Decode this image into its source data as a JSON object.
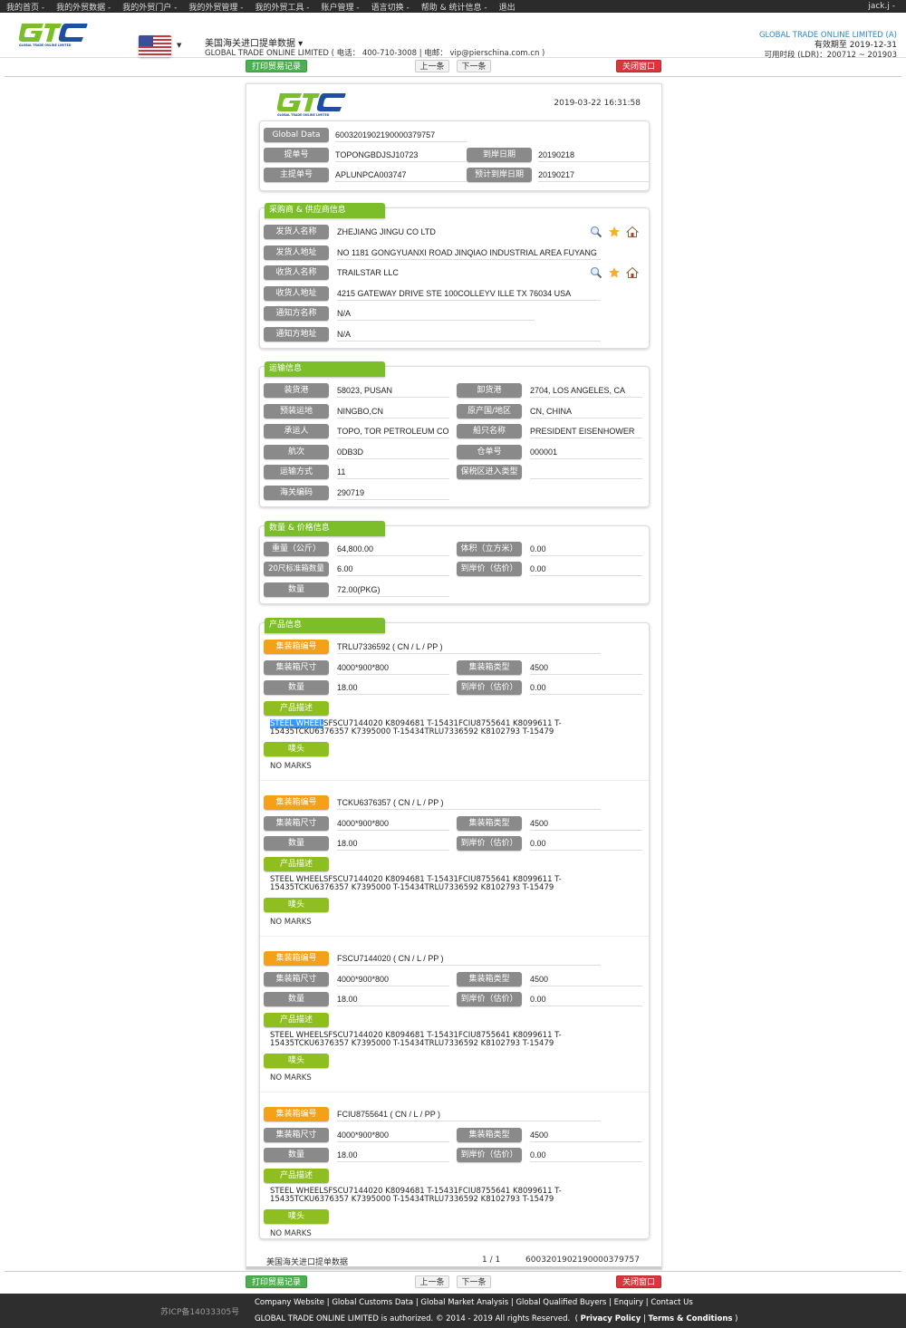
{
  "topnav": {
    "items": [
      "我的首页 -",
      "我的外贸数据 -",
      "我的外贸门户 -",
      "我的外贸管理 -",
      "我的外贸工具 -",
      "账户管理 -",
      "语言切换 -",
      "帮助 & 统计信息 -",
      "退出"
    ],
    "user": "jack.j -"
  },
  "header": {
    "logo_text": "GLOBAL TRADE ONLINE LIMITED",
    "flag": "us-flag",
    "db_title": "美国海关进口提单数据 ▾",
    "db_sub": "GLOBAL TRADE ONLINE LIMITED ( 电话： 400-710-3008 | 电邮： vip@pierschina.com.cn )",
    "company": "GLOBAL TRADE ONLINE LIMITED (A)",
    "valid_until": "有效期至 2019-12-31",
    "ldr": "可用时段 (LDR)：200712 ~ 201903"
  },
  "actions": {
    "print": "打印贸易记录",
    "prev": "上一条",
    "next": "下一条",
    "close": "关闭窗口"
  },
  "doc": {
    "timestamp": "2019-03-22 16:31:58",
    "basic": {
      "global_data_label": "Global Data",
      "global_data": "6003201902190000379757",
      "bill_no_label": "提单号",
      "bill_no": "TOPONGBDJSJ10723",
      "arrival_date_label": "到岸日期",
      "arrival_date": "20190218",
      "master_bill_label": "主提单号",
      "master_bill": "APLUNPCA003747",
      "est_arrival_label": "预计到岸日期",
      "est_arrival": "20190217"
    },
    "parties": {
      "title": "采购商 & 供应商信息",
      "shipper_name_label": "发货人名称",
      "shipper_name": "ZHEJIANG JINGU CO LTD",
      "shipper_addr_label": "发货人地址",
      "shipper_addr": " NO 1181 GONGYUANXI ROAD JINQIAO INDUSTRIAL AREA FUYANG",
      "consignee_name_label": "收货人名称",
      "consignee_name": "TRAILSTAR LLC",
      "consignee_addr_label": "收货人地址",
      "consignee_addr": "4215 GATEWAY DRIVE STE 100COLLEYV ILLE TX 76034 USA",
      "notify_name_label": "通知方名称",
      "notify_name": "N/A",
      "notify_addr_label": "通知方地址",
      "notify_addr": "N/A"
    },
    "transport": {
      "title": "运输信息",
      "load_port_label": "装货港",
      "load_port": "58023, PUSAN",
      "unload_port_label": "卸货港",
      "unload_port": "2704, LOS ANGELES, CA",
      "pre_load_label": "预装运地",
      "pre_load": "NINGBO,CN",
      "origin_label": "原产国/地区",
      "origin": "CN, CHINA",
      "carrier_label": "承运人",
      "carrier": "TOPO, TOR PETROLEUM CO",
      "vessel_label": "船只名称",
      "vessel": "PRESIDENT EISENHOWER",
      "voyage_label": "航次",
      "voyage": "0DB3D",
      "manifest_label": "仓单号",
      "manifest": "000001",
      "mode_label": "运输方式",
      "mode": "11",
      "bonded_label": "保税区进入类型",
      "bonded": "",
      "customs_code_label": "海关编码",
      "customs_code": "290719"
    },
    "quantity": {
      "title": "数量 & 价格信息",
      "weight_label": "重量（公斤）",
      "weight": "64,800.00",
      "volume_label": "体积（立方米）",
      "volume": "0.00",
      "teu_label": "20尺标准箱数量",
      "teu": "6.00",
      "value_label": "到岸价（估价）",
      "value": "0.00",
      "qty_label": "数量",
      "qty": "72.00(PKG)"
    },
    "products": {
      "title": "产品信息",
      "labels": {
        "container_no": "集装箱编号",
        "container_size": "集装箱尺寸",
        "container_type": "集装箱类型",
        "qty": "数量",
        "value": "到岸价（估价）",
        "desc": "产品描述",
        "marks": "唛头"
      },
      "items": [
        {
          "container_no": "TRLU7336592 ( CN / L / PP )",
          "size": "4000*900*800",
          "type": "4500",
          "qty": "18.00",
          "value": "0.00",
          "desc_highlight": "STEEL WHEEL",
          "desc_rest": "SFSCU7144020 K8094681 T-15431FCIU8755641 K8099611 T-15435TCKU6376357 K7395000 T-15434TRLU7336592 K8102793 T-15479",
          "marks": "NO MARKS"
        },
        {
          "container_no": "TCKU6376357 ( CN / L / PP )",
          "size": "4000*900*800",
          "type": "4500",
          "qty": "18.00",
          "value": "0.00",
          "desc_highlight": "",
          "desc_rest": "STEEL WHEELSFSCU7144020 K8094681 T-15431FCIU8755641 K8099611 T-15435TCKU6376357 K7395000 T-15434TRLU7336592 K8102793 T-15479",
          "marks": "NO MARKS"
        },
        {
          "container_no": "FSCU7144020 ( CN / L / PP )",
          "size": "4000*900*800",
          "type": "4500",
          "qty": "18.00",
          "value": "0.00",
          "desc_highlight": "",
          "desc_rest": "STEEL WHEELSFSCU7144020 K8094681 T-15431FCIU8755641 K8099611 T-15435TCKU6376357 K7395000 T-15434TRLU7336592 K8102793 T-15479",
          "marks": "NO MARKS"
        },
        {
          "container_no": "FCIU8755641 ( CN / L / PP )",
          "size": "4000*900*800",
          "type": "4500",
          "qty": "18.00",
          "value": "0.00",
          "desc_highlight": "",
          "desc_rest": "STEEL WHEELSFSCU7144020 K8094681 T-15431FCIU8755641 K8099611 T-15435TCKU6376357 K7395000 T-15434TRLU7336592 K8102793 T-15479",
          "marks": "NO MARKS"
        }
      ]
    },
    "footer": {
      "left": "美国海关进口提单数据",
      "page": "1 / 1",
      "id": "6003201902190000379757"
    }
  },
  "footer": {
    "icp": "苏ICP备14033305号",
    "links": [
      "Company Website",
      "Global Customs Data",
      "Global Market Analysis",
      "Global Qualified Buyers",
      "Enquiry",
      "Contact Us"
    ],
    "copyright": "GLOBAL TRADE ONLINE LIMITED is authorized. © 2014 - 2019 All rights Reserved.",
    "privacy": "Privacy Policy",
    "terms": "Terms & Conditions"
  },
  "colors": {
    "brand_green": "#7cbe2a",
    "brand_blue": "#1f4fa0",
    "label_gray": "#8a8a8a",
    "label_orange": "#f5a117",
    "close_red": "#d9363e"
  }
}
